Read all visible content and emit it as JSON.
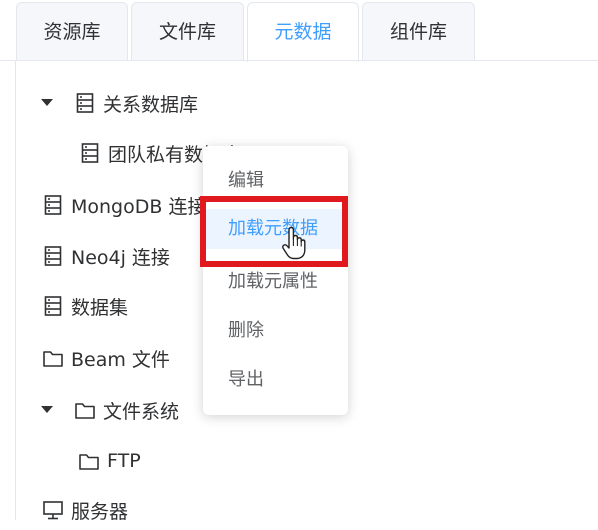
{
  "tabs": [
    {
      "label": "资源库",
      "active": false
    },
    {
      "label": "文件库",
      "active": false
    },
    {
      "label": "元数据",
      "active": true
    },
    {
      "label": "组件库",
      "active": false
    }
  ],
  "tree": {
    "relational_db": {
      "label": "关系数据库",
      "icon": "database-icon",
      "expanded": true
    },
    "team_private_db": {
      "label": "团队私有数据库",
      "icon": "database-icon"
    },
    "mongodb": {
      "label": "MongoDB 连接",
      "icon": "database-icon"
    },
    "neo4j": {
      "label": "Neo4j 连接",
      "icon": "database-icon"
    },
    "dataset": {
      "label": "数据集",
      "icon": "database-icon"
    },
    "beam_files": {
      "label": "Beam 文件",
      "icon": "folder-icon"
    },
    "file_system": {
      "label": "文件系统",
      "icon": "folder-icon",
      "expanded": true
    },
    "ftp": {
      "label": "FTP",
      "icon": "folder-icon"
    },
    "server": {
      "label": "服务器",
      "icon": "monitor-icon"
    }
  },
  "context_menu": {
    "items": [
      {
        "label": "编辑"
      },
      {
        "label": "加载元数据",
        "active": true
      },
      {
        "label": "加载元属性"
      },
      {
        "label": "删除"
      },
      {
        "label": "导出"
      }
    ]
  },
  "colors": {
    "accent": "#409eff",
    "highlight_box": "#e0191e",
    "active_item_bg": "#ecf5ff"
  }
}
